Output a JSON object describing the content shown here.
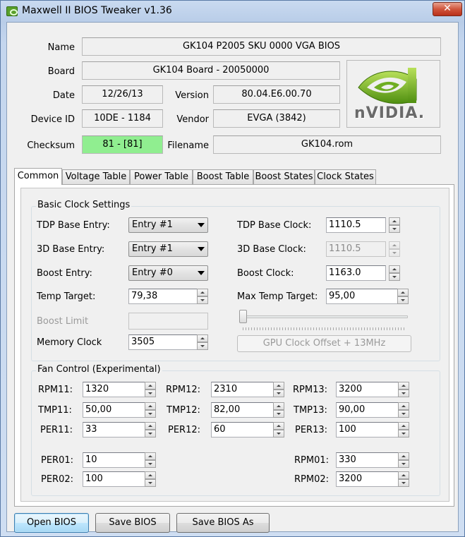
{
  "window": {
    "title": "Maxwell II BIOS Tweaker v1.36",
    "close_glyph": "✕"
  },
  "info": {
    "name_label": "Name",
    "name_value": "GK104 P2005 SKU 0000 VGA BIOS",
    "board_label": "Board",
    "board_value": "GK104 Board - 20050000",
    "date_label": "Date",
    "date_value": "12/26/13",
    "version_label": "Version",
    "version_value": "80.04.E6.00.70",
    "device_label": "Device ID",
    "device_value": "10DE - 1184",
    "vendor_label": "Vendor",
    "vendor_value": "EVGA (3842)",
    "checksum_label": "Checksum",
    "checksum_value": "81 - [81]",
    "filename_label": "Filename",
    "filename_value": "GK104.rom",
    "logo_text": "nVIDIA."
  },
  "tabs": [
    "Common",
    "Voltage Table",
    "Power Table",
    "Boost Table",
    "Boost States",
    "Clock States"
  ],
  "basic": {
    "title": "Basic Clock Settings",
    "tdp_entry_label": "TDP Base Entry:",
    "tdp_entry_value": "Entry #1",
    "d3_entry_label": "3D Base Entry:",
    "d3_entry_value": "Entry #1",
    "boost_entry_label": "Boost Entry:",
    "boost_entry_value": "Entry #0",
    "temp_target_label": "Temp Target:",
    "temp_target_value": "79,38",
    "boost_limit_label": "Boost Limit",
    "memory_clock_label": "Memory Clock",
    "memory_clock_value": "3505",
    "tdp_clock_label": "TDP Base Clock:",
    "tdp_clock_value": "1110.5",
    "d3_clock_label": "3D Base Clock:",
    "d3_clock_value": "1110.5",
    "boost_clock_label": "Boost Clock:",
    "boost_clock_value": "1163.0",
    "max_temp_label": "Max Temp Target:",
    "max_temp_value": "95,00",
    "gpu_offset_label": "GPU Clock Offset + 13MHz"
  },
  "fan": {
    "title": "Fan Control (Experimental)",
    "rpm11_label": "RPM11:",
    "rpm11": "1320",
    "rpm12_label": "RPM12:",
    "rpm12": "2310",
    "rpm13_label": "RPM13:",
    "rpm13": "3200",
    "tmp11_label": "TMP11:",
    "tmp11": "50,00",
    "tmp12_label": "TMP12:",
    "tmp12": "82,00",
    "tmp13_label": "TMP13:",
    "tmp13": "90,00",
    "per11_label": "PER11:",
    "per11": "33",
    "per12_label": "PER12:",
    "per12": "60",
    "per13_label": "PER13:",
    "per13": "100",
    "per01_label": "PER01:",
    "per01": "10",
    "per02_label": "PER02:",
    "per02": "100",
    "rpm01_label": "RPM01:",
    "rpm01": "330",
    "rpm02_label": "RPM02:",
    "rpm02": "3200"
  },
  "buttons": {
    "open": "Open BIOS",
    "save": "Save BIOS",
    "save_as": "Save BIOS As"
  },
  "colors": {
    "checksum_ok": "#90ee90",
    "nvidia_green": "#76b900"
  }
}
